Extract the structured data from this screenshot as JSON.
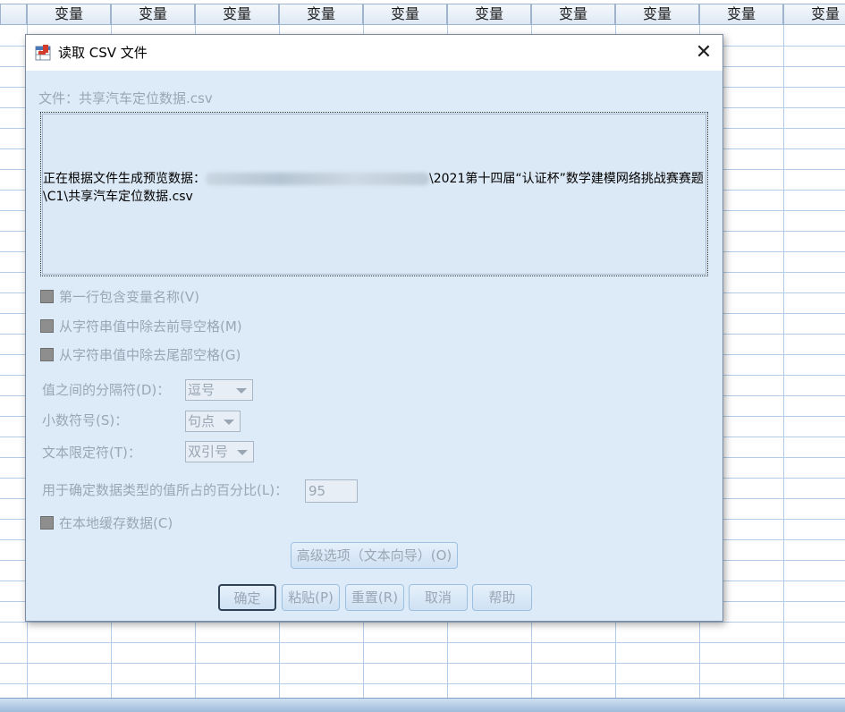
{
  "sheet": {
    "column_header": "变量",
    "column_count": 10
  },
  "dialog": {
    "title": "读取 CSV 文件",
    "close_label": "✕",
    "file_label": "文件：",
    "file_name": "共享汽车定位数据.csv",
    "preview_text_prefix": "正在根据文件生成预览数据：",
    "preview_text_suffix": "\\2021第十四届“认证杯”数学建模网络挑战赛赛题\\C1\\共享汽车定位数据.csv",
    "checkbox_first_row": "第一行包含变量名称(V)",
    "checkbox_trim_leading": "从字符串值中除去前导空格(M)",
    "checkbox_trim_trailing": "从字符串值中除去尾部空格(G)",
    "delimiter_label": "值之间的分隔符(D)：",
    "delimiter_value": "逗号",
    "decimal_label": "小数符号(S)：",
    "decimal_value": "句点",
    "qualifier_label": "文本限定符(T)：",
    "qualifier_value": "双引号",
    "percent_label": "用于确定数据类型的值所占的百分比(L)：",
    "percent_value": "95",
    "checkbox_cache": "在本地缓存数据(C)",
    "advanced_button": "高级选项（文本向导）(O)",
    "buttons": {
      "ok": "确定",
      "paste": "粘贴(P)",
      "reset": "重置(R)",
      "cancel": "取消",
      "help": "帮助"
    }
  }
}
